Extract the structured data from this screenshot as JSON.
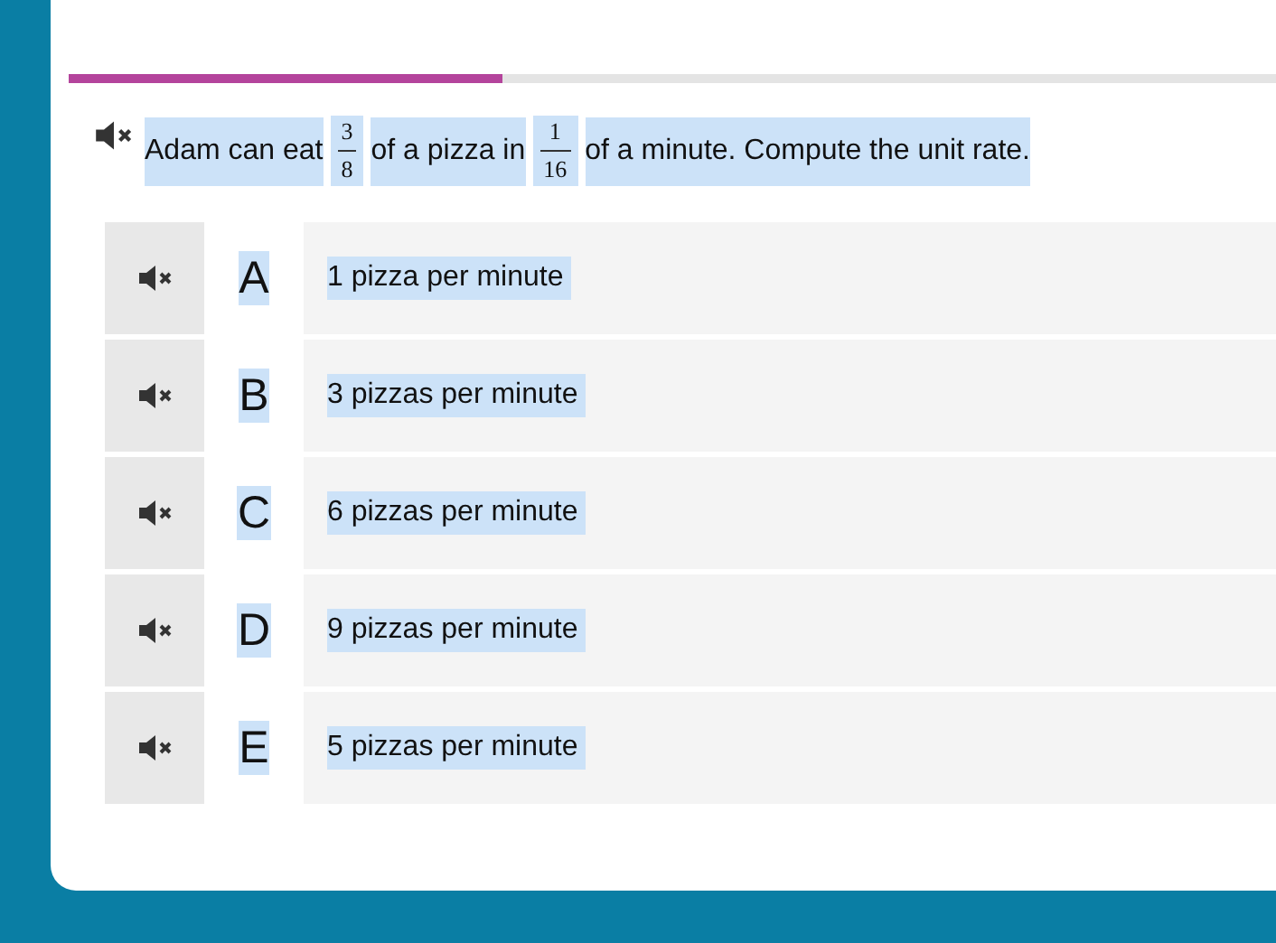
{
  "progress": {
    "level": 0.36
  },
  "question": {
    "segments": [
      {
        "kind": "text",
        "text": "Adam can eat"
      },
      {
        "kind": "fraction",
        "numerator": "3",
        "denominator": "8"
      },
      {
        "kind": "text",
        "text": "of a pizza in"
      },
      {
        "kind": "fraction",
        "numerator": "1",
        "denominator": "16"
      },
      {
        "kind": "text",
        "text": "of a minute. Compute the unit rate."
      }
    ]
  },
  "options": [
    {
      "letter": "A",
      "text": "1 pizza per minute"
    },
    {
      "letter": "B",
      "text": "3 pizzas per minute"
    },
    {
      "letter": "C",
      "text": "6 pizzas per minute"
    },
    {
      "letter": "D",
      "text": "9 pizzas per minute"
    },
    {
      "letter": "E",
      "text": "5 pizzas per minute"
    }
  ]
}
